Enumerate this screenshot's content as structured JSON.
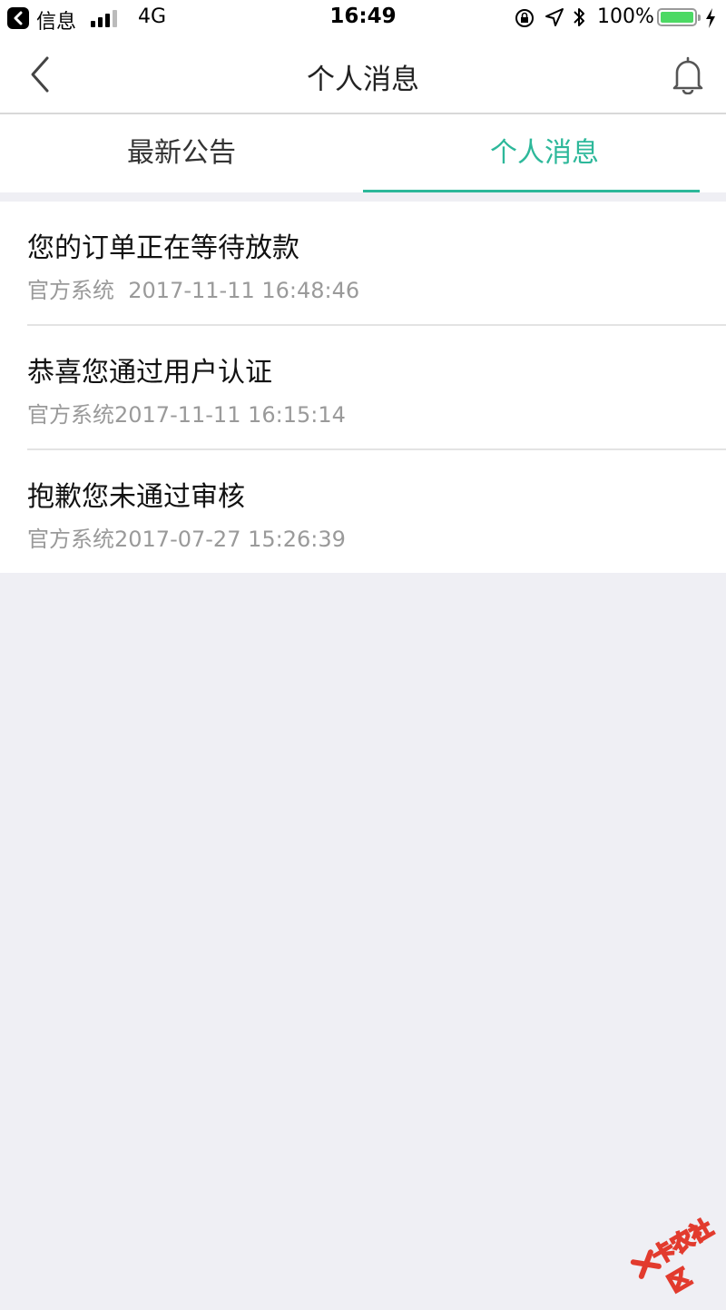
{
  "status_bar": {
    "carrier": "信息",
    "network": "4G",
    "time": "16:49",
    "battery_percent": "100%",
    "battery_level": 1.0
  },
  "nav": {
    "title": "个人消息"
  },
  "tabs": [
    {
      "label": "最新公告",
      "active": false
    },
    {
      "label": "个人消息",
      "active": true
    }
  ],
  "messages": [
    {
      "title": "您的订单正在等待放款",
      "meta": "官方系统  2017-11-11 16:48:46"
    },
    {
      "title": "恭喜您通过用户认证",
      "meta": "官方系统2017-11-11 16:15:14"
    },
    {
      "title": "抱歉您未通过审核",
      "meta": "官方系统2017-07-27 15:26:39"
    }
  ],
  "watermark": {
    "text": "卡农社区"
  },
  "colors": {
    "accent": "#2db89a",
    "background": "#efeff4",
    "battery": "#4cd964"
  }
}
